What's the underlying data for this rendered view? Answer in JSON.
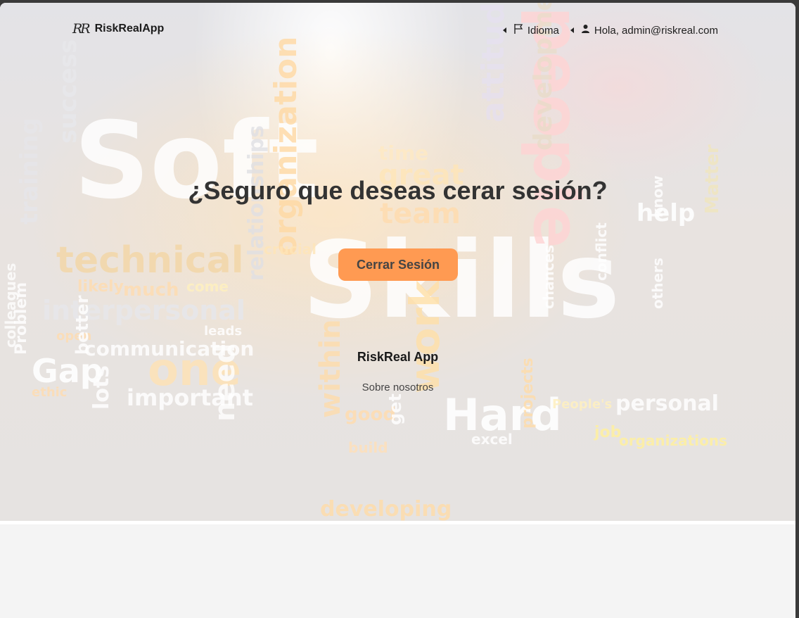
{
  "navbar": {
    "logo_text": "RR",
    "brand_name": "RiskRealApp",
    "language_label": "Idioma",
    "user_greeting": "Hola, admin@riskreal.com"
  },
  "main": {
    "title": "¿Seguro que deseas cerar sesión?",
    "logout_button": "Cerrar Sesión"
  },
  "footer": {
    "app_name": "RiskReal App",
    "about_link": "Sobre nosotros"
  },
  "background": {
    "words": [
      "Soft",
      "Skills",
      "people",
      "technical",
      "interpersonal",
      "communication",
      "Gap",
      "one",
      "important",
      "organization",
      "relationships",
      "Hard",
      "work",
      "within",
      "developing",
      "personal",
      "organizations",
      "help",
      "team",
      "great",
      "time",
      "attitude",
      "development",
      "training",
      "success",
      "crucial",
      "much",
      "likely",
      "come",
      "leads",
      "open",
      "ethic",
      "lots",
      "need",
      "good",
      "get",
      "build",
      "job",
      "excel",
      "People's",
      "conflict",
      "others",
      "Matter",
      "know",
      "chances",
      "projects",
      "better",
      "Problem",
      "colleagues"
    ]
  },
  "colors": {
    "accent": "#ff9a52",
    "title": "#333333"
  }
}
